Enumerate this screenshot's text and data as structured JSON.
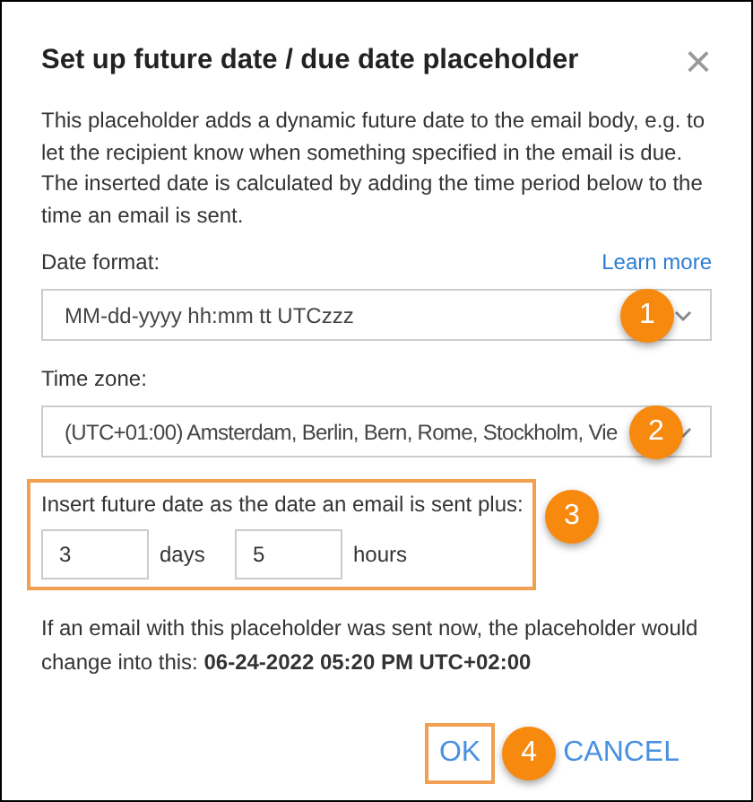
{
  "dialog": {
    "title": "Set up future date / due date placeholder",
    "close": "×",
    "description": "This placeholder adds a dynamic future date to the email body, e.g. to let the recipient know when something specified in the email is due. The inserted date is calculated by adding the time period below to the time an email is sent.",
    "date_format": {
      "label": "Date format:",
      "link": "Learn more",
      "value": "MM-dd-yyyy hh:mm tt UTCzzz"
    },
    "time_zone": {
      "label": "Time zone:",
      "value": "(UTC+01:00) Amsterdam, Berlin, Bern, Rome, Stockholm, Vie"
    },
    "offset": {
      "label": "Insert future date as the date an email is sent plus:",
      "days": "3",
      "days_unit": "days",
      "hours": "5",
      "hours_unit": "hours"
    },
    "preview": "If an email with this placeholder was sent now, the placeholder would change into this: **06-24-2022 05:20 PM UTC+02:00**",
    "buttons": [
      "OK",
      "CANCEL"
    ]
  },
  "annotations": [
    "1",
    "2",
    "3",
    "4"
  ]
}
